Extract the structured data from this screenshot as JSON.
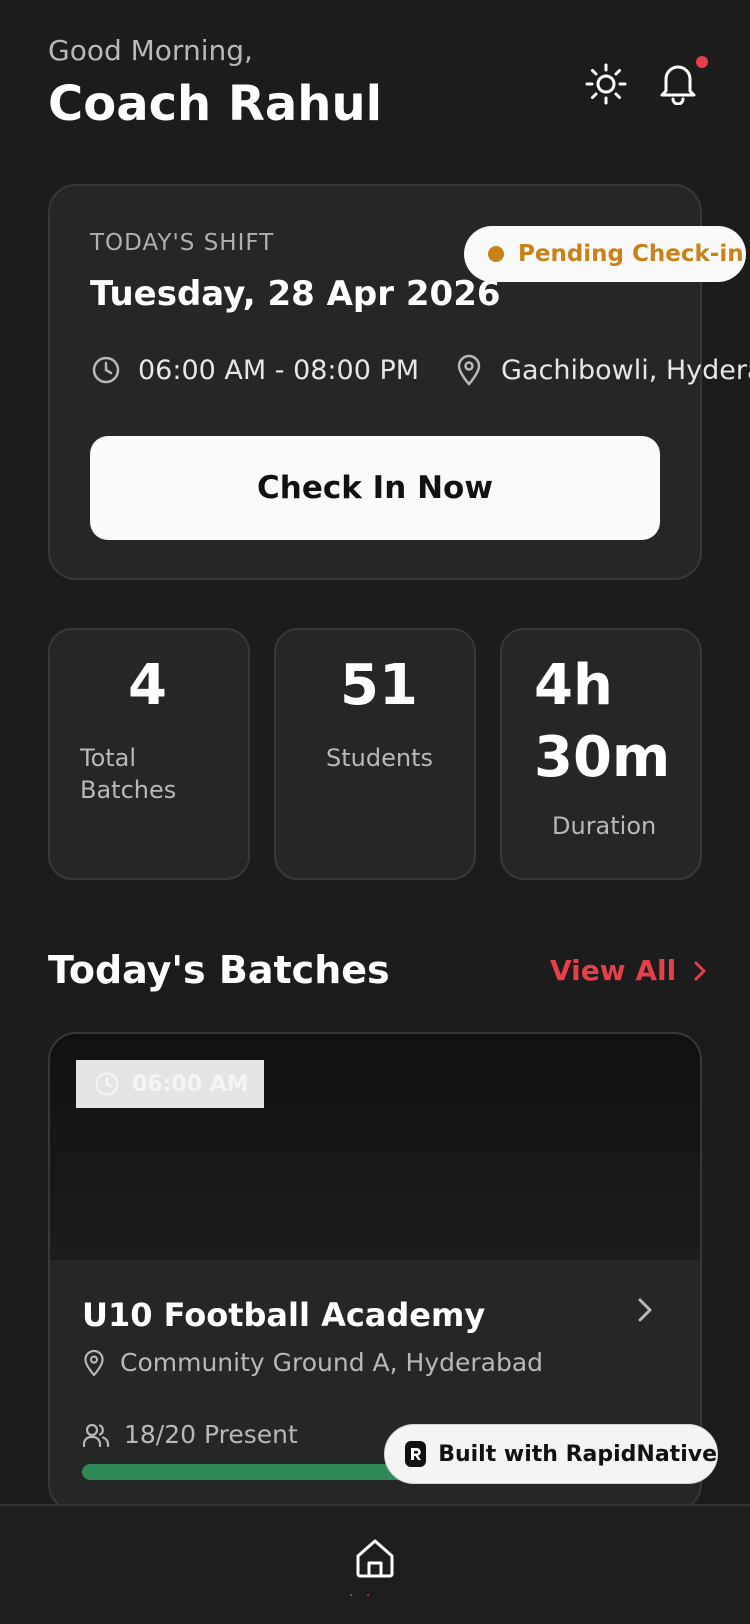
{
  "header": {
    "greeting": "Good Morning,",
    "name": "Coach Rahul",
    "icons": [
      "sun-icon",
      "bell-icon"
    ]
  },
  "shift": {
    "label": "TODAY'S SHIFT",
    "date": "Tuesday, 28 Apr 2026",
    "time": "06:00 AM - 08:00 PM",
    "location": "Gachibowli, Hyderabad",
    "status": "Pending Check-in",
    "status_color": "#c9821a",
    "check_in_label": "Check In Now"
  },
  "stats": [
    {
      "value": "4",
      "label_line1": "Total",
      "label_line2": "Batches"
    },
    {
      "value": "51",
      "label": "Students"
    },
    {
      "value_line1": "4h",
      "value_line2": "30m",
      "label": "Duration"
    }
  ],
  "batches_section": {
    "title": "Today's Batches",
    "view_all": "View All",
    "accent": "#e5404a"
  },
  "batches": [
    {
      "time": "06:00 AM",
      "name": "U10 Football Academy",
      "location": "Community Ground A, Hyderabad",
      "present": "18/20 Present",
      "present_fraction": 0.9,
      "bar_color": "#2e8b57"
    }
  ],
  "badge": {
    "label": "Built with RapidNative"
  },
  "nav": {
    "items": [
      "home-icon"
    ]
  }
}
